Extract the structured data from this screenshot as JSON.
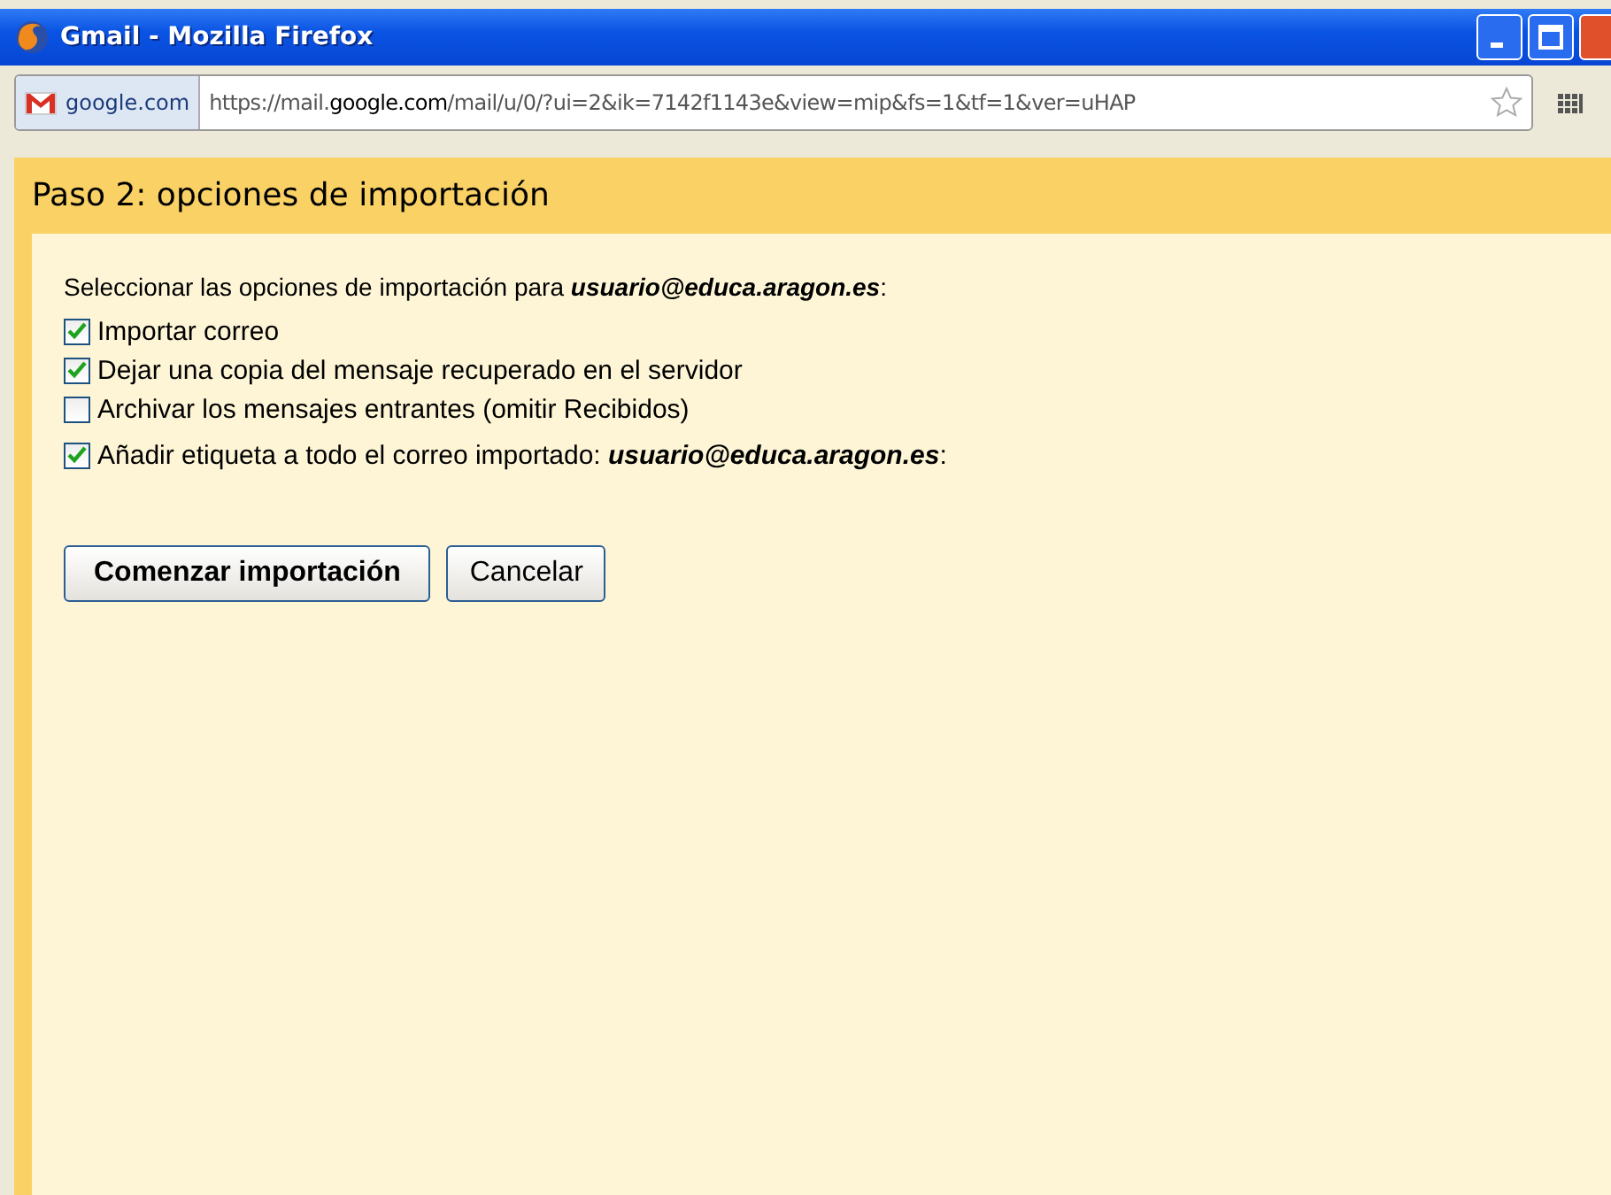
{
  "window": {
    "title": "Gmail - Mozilla Firefox"
  },
  "address_bar": {
    "site": "google.com",
    "url_scheme": "https://mail.",
    "url_domain": "google.com",
    "url_path": "/mail/u/0/?ui=2&ik=7142f1143e&view=mip&fs=1&tf=1&ver=uHAP"
  },
  "page": {
    "heading": "Paso 2: opciones de importación",
    "intro": "Seleccionar las opciones de importación para **usuario@educa.aragon.es**:",
    "options": [
      {
        "label": "Importar correo",
        "checked": true
      },
      {
        "label": "Dejar una copia del mensaje recuperado en el servidor",
        "checked": true
      },
      {
        "label": "Archivar los mensajes entrantes (omitir Recibidos)",
        "checked": false
      },
      {
        "label": "Añadir etiqueta a todo el correo importado:  **usuario@educa.aragon.es**:",
        "checked": true
      }
    ],
    "buttons": [
      {
        "label": "Comenzar importación",
        "kind": "primary"
      },
      {
        "label": "Cancelar",
        "kind": "secondary"
      }
    ]
  }
}
